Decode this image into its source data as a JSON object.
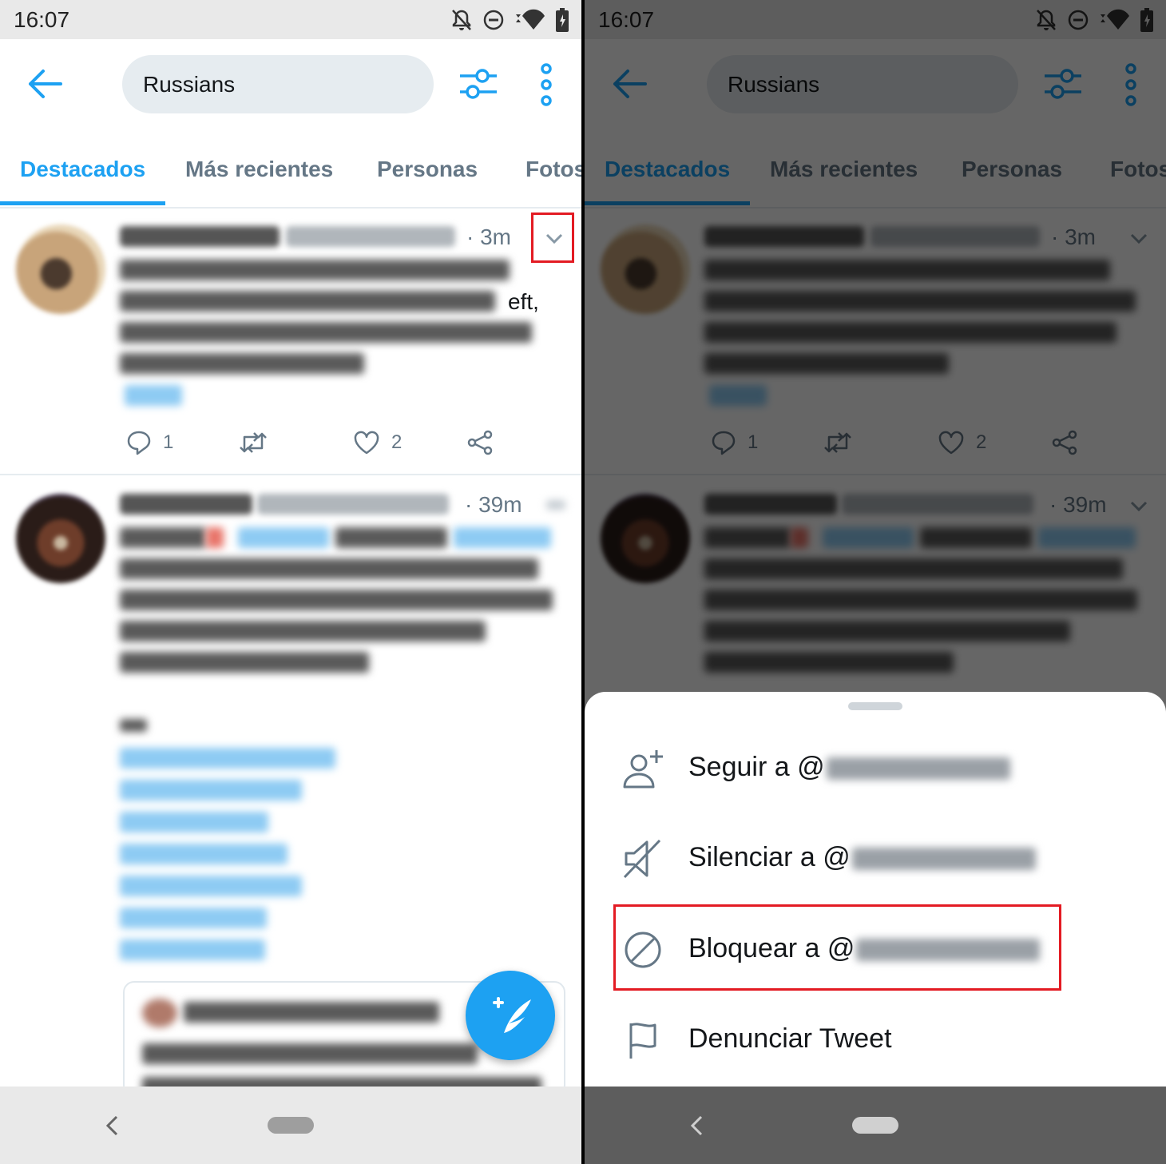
{
  "status": {
    "time": "16:07"
  },
  "search": {
    "query": "Russians"
  },
  "tabs": [
    "Destacados",
    "Más recientes",
    "Personas",
    "Fotos"
  ],
  "tweets": [
    {
      "time": "· 3m",
      "visible_fragment": "eft,",
      "reply_count": "1",
      "like_count": "2"
    },
    {
      "time": "· 39m"
    }
  ],
  "sheet": {
    "items": [
      {
        "label": "Seguir a @",
        "icon": "follow-user-icon"
      },
      {
        "label": "Silenciar a @",
        "icon": "mute-icon"
      },
      {
        "label": "Bloquear a @",
        "icon": "block-icon"
      },
      {
        "label": "Denunciar Tweet",
        "icon": "flag-icon"
      }
    ]
  },
  "colors": {
    "accent": "#1da1f2",
    "highlight": "#e31b23",
    "secondary_text": "#657786"
  }
}
